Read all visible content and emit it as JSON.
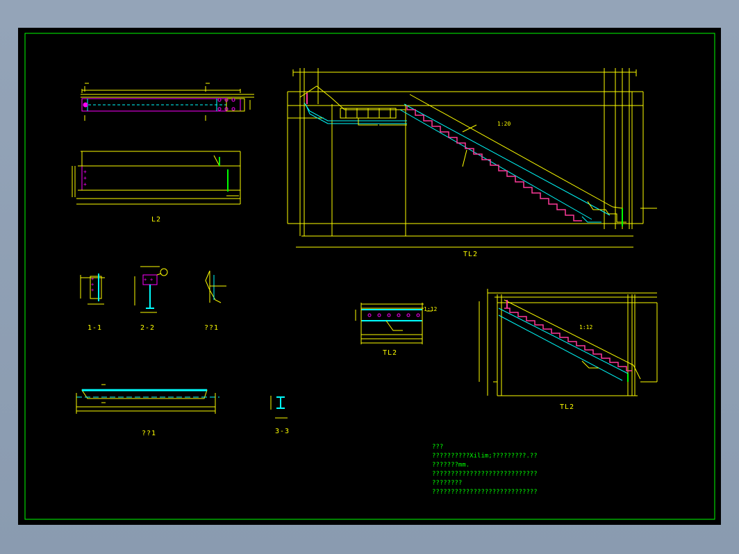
{
  "drawing_labels": {
    "L2": "L2",
    "sec_1_1": "1-1",
    "sec_2_2": "2-2",
    "detail_1": "??1",
    "detail_2": "??1",
    "sec_3_3": "3-3",
    "TL2_main": "TL2",
    "TL2_small": "TL2",
    "TL2_mid": "TL2"
  },
  "slope_labels": {
    "main": "1:20",
    "right": "1:12",
    "small": "1:12"
  },
  "notes": {
    "heading": "???",
    "line1": "??????????Xilim;?????????.??",
    "line2": "  ???????mm.",
    "line3": "????????????????????????????",
    "line4": "  ????????",
    "line5": "????????????????????????????"
  },
  "colors": {
    "frame": "#00ff00",
    "dims": "#ffff00",
    "stairs_pink": "#ff3a9a",
    "steel_cyan": "#00ffff",
    "steel_magenta": "#ff00ff"
  }
}
